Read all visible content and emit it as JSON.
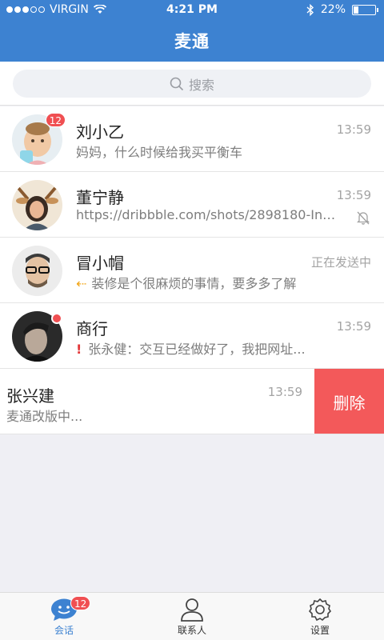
{
  "status_bar": {
    "carrier": "VIRGIN",
    "time": "4:21 PM",
    "battery": "22%",
    "battery_level": 0.22
  },
  "header": {
    "title": "麦通"
  },
  "search": {
    "placeholder": "搜索"
  },
  "conversations": [
    {
      "name": "刘小乙",
      "time": "13:59",
      "preview": "妈妈，什么时候给我买平衡车",
      "unread": "12"
    },
    {
      "name": "董宁静",
      "time": "13:59",
      "preview": "https://dribbble.com/shots/2898180-Inter..."
    },
    {
      "name": "冒小帽",
      "time": "正在发送中",
      "preview": "装修是个很麻烦的事情，要多多了解"
    },
    {
      "name": "商行",
      "time": "13:59",
      "preview": "张永健：交互已经做好了，我把网址..."
    },
    {
      "name": "张兴建",
      "time": "13:59",
      "preview": "麦通改版中..."
    }
  ],
  "swipe_action": {
    "delete_label": "删除"
  },
  "tabbar": {
    "tabs": [
      {
        "label": "会话",
        "badge": "12"
      },
      {
        "label": "联系人"
      },
      {
        "label": "设置"
      }
    ]
  },
  "colors": {
    "brand": "#3d82d1",
    "badge": "#f04f52",
    "delete": "#f3595a",
    "sending_arrow": "#f2a516",
    "warning": "#e3383a"
  }
}
